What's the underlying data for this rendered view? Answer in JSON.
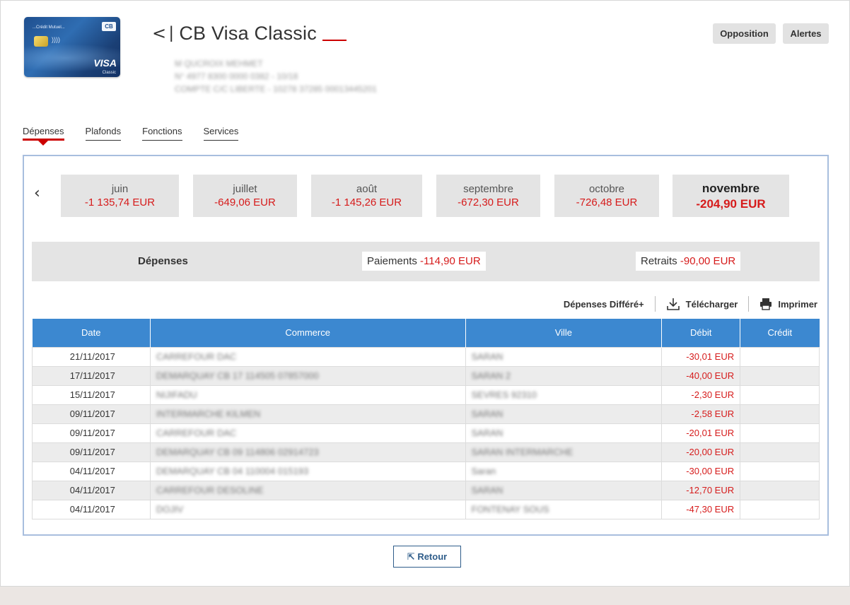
{
  "header": {
    "title": "CB Visa Classic",
    "back_glyph": "<",
    "card": {
      "bank_text": "...Crédit Mutuel...",
      "cb_logo": "CB",
      "brand": "VISA",
      "brand_sub": "Classic",
      "contactless_glyph": "))))"
    },
    "info_lines": [
      "M QUCROIX MEHMET",
      "N° 4977 8300 0000 0382 - 10/18",
      "COMPTE C/C LIBERTE - 10278 37285 00013445201"
    ],
    "buttons": {
      "opposition": "Opposition",
      "alertes": "Alertes"
    }
  },
  "tabs": [
    {
      "label": "Dépenses",
      "active": true
    },
    {
      "label": "Plafonds",
      "active": false
    },
    {
      "label": "Fonctions",
      "active": false
    },
    {
      "label": "Services",
      "active": false
    }
  ],
  "months": [
    {
      "name": "juin",
      "amount": "-1 135,74 EUR"
    },
    {
      "name": "juillet",
      "amount": "-649,06 EUR"
    },
    {
      "name": "août",
      "amount": "-1 145,26 EUR"
    },
    {
      "name": "septembre",
      "amount": "-672,30 EUR"
    },
    {
      "name": "octobre",
      "amount": "-726,48 EUR"
    },
    {
      "name": "novembre",
      "amount": "-204,90 EUR",
      "active": true
    }
  ],
  "summary": {
    "title": "Dépenses",
    "paiements_label": "Paiements",
    "paiements_amount": "-114,90 EUR",
    "retraits_label": "Retraits",
    "retraits_amount": "-90,00 EUR"
  },
  "actions": {
    "differe": "Dépenses Différé+",
    "telecharger": "Télécharger",
    "imprimer": "Imprimer"
  },
  "table": {
    "headers": [
      "Date",
      "Commerce",
      "Ville",
      "Débit",
      "Crédit"
    ],
    "rows": [
      {
        "date": "21/11/2017",
        "commerce": "CARREFOUR DAC",
        "ville": "SARAN",
        "debit": "-30,01 EUR",
        "credit": ""
      },
      {
        "date": "17/11/2017",
        "commerce": "DEMARQUAY CB 17 114505 07857000",
        "ville": "SARAN 2",
        "debit": "-40,00 EUR",
        "credit": ""
      },
      {
        "date": "15/11/2017",
        "commerce": "NIJIFADU",
        "ville": "SEVRES 92310",
        "debit": "-2,30 EUR",
        "credit": ""
      },
      {
        "date": "09/11/2017",
        "commerce": "INTERMARCHE KILMEN",
        "ville": "SARAN",
        "debit": "-2,58 EUR",
        "credit": ""
      },
      {
        "date": "09/11/2017",
        "commerce": "CARREFOUR DAC",
        "ville": "SARAN",
        "debit": "-20,01 EUR",
        "credit": ""
      },
      {
        "date": "09/11/2017",
        "commerce": "DEMARQUAY CB 09 114806 02914723",
        "ville": "SARAN INTERMARCHE",
        "debit": "-20,00 EUR",
        "credit": ""
      },
      {
        "date": "04/11/2017",
        "commerce": "DEMARQUAY CB 04 110004 015193",
        "ville": "Saran",
        "debit": "-30,00 EUR",
        "credit": ""
      },
      {
        "date": "04/11/2017",
        "commerce": "CARREFOUR DESOLINE",
        "ville": "SARAN",
        "debit": "-12,70 EUR",
        "credit": ""
      },
      {
        "date": "04/11/2017",
        "commerce": "DOJIV",
        "ville": "FONTENAY SOUS",
        "debit": "-47,30 EUR",
        "credit": ""
      }
    ]
  },
  "footer": {
    "retour": "Retour",
    "retour_glyph": "⇱"
  },
  "colors": {
    "accent_red": "#d61b1b",
    "header_blue": "#3c88d0",
    "panel_border": "#a8bede"
  }
}
